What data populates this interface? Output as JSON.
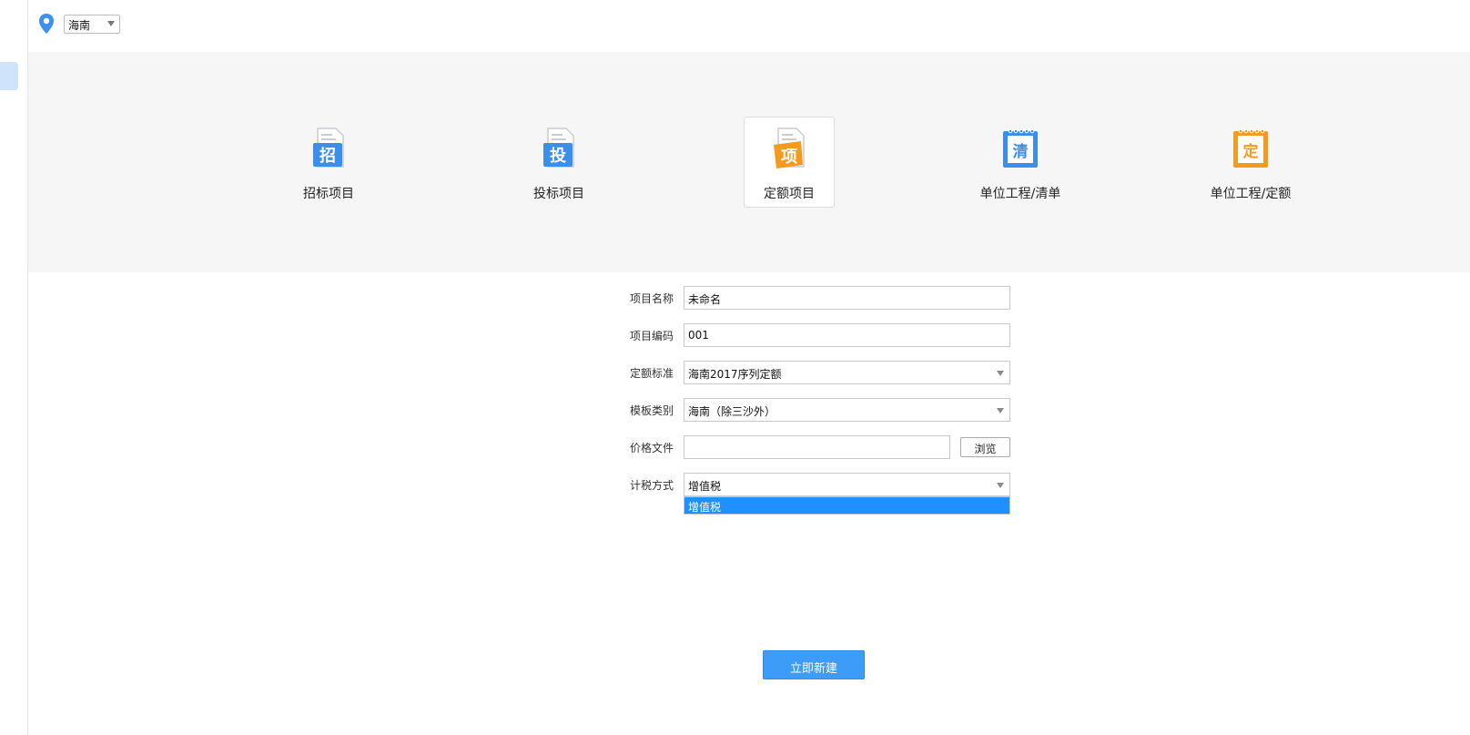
{
  "region": {
    "selected": "海南"
  },
  "project_types": [
    {
      "label": "招标项目",
      "glyph": "招",
      "color": "#3b8eea",
      "icon": "document-icon",
      "selected": false
    },
    {
      "label": "投标项目",
      "glyph": "投",
      "color": "#3b8eea",
      "icon": "document-icon",
      "selected": false
    },
    {
      "label": "定额项目",
      "glyph": "项",
      "color": "#f39b1f",
      "icon": "document-icon",
      "selected": true
    },
    {
      "label": "单位工程/清单",
      "glyph": "清",
      "color": "#3b8eea",
      "icon": "notebook-icon",
      "selected": false
    },
    {
      "label": "单位工程/定额",
      "glyph": "定",
      "color": "#f39b1f",
      "icon": "notebook-icon",
      "selected": false
    }
  ],
  "form": {
    "project_name": {
      "label": "项目名称",
      "value": "未命名"
    },
    "project_code": {
      "label": "项目编码",
      "value": "001"
    },
    "quota_standard": {
      "label": "定额标准",
      "value": "海南2017序列定额"
    },
    "template_category": {
      "label": "模板类别",
      "value": "海南（除三沙外）"
    },
    "price_file": {
      "label": "价格文件",
      "value": "",
      "browse_label": "浏览"
    },
    "tax_method": {
      "label": "计税方式",
      "value": "增值税",
      "options": [
        "增值税"
      ]
    }
  },
  "submit_label": "立即新建",
  "colors": {
    "accent": "#3d9cf7",
    "highlight": "#1e90ff",
    "orange": "#f39b1f"
  }
}
